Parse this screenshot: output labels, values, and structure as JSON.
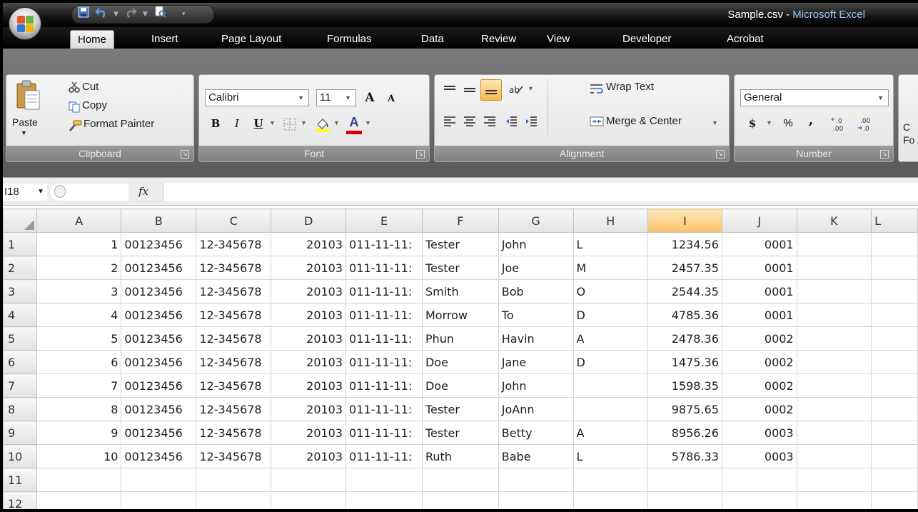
{
  "window": {
    "file_title": "Sample.csv",
    "title_sep": " - ",
    "app_title": "Microsoft Excel"
  },
  "qat": [
    "save-icon",
    "undo-icon",
    "redo-icon",
    "customize-icon"
  ],
  "tabs": [
    "Home",
    "Insert",
    "Page Layout",
    "Formulas",
    "Data",
    "Review",
    "View",
    "Developer",
    "Acrobat"
  ],
  "active_tab": "Home",
  "ribbon": {
    "clipboard": {
      "label": "Clipboard",
      "paste": "Paste",
      "cut": "Cut",
      "copy": "Copy",
      "format_painter": "Format Painter"
    },
    "font": {
      "label": "Font",
      "name": "Calibri",
      "size": "11",
      "grow": "A",
      "shrink": "A",
      "bold": "B",
      "italic": "I",
      "underline": "U",
      "font_color_glyph": "A"
    },
    "alignment": {
      "label": "Alignment",
      "wrap_text": "Wrap Text",
      "merge_center": "Merge & Center"
    },
    "number": {
      "label": "Number",
      "format": "General",
      "currency": "$",
      "percent": "%",
      "comma": ","
    },
    "cut_off": "C\nFo"
  },
  "formula_bar": {
    "cell_ref": "I18",
    "fx": "fx",
    "formula": ""
  },
  "columns": [
    "A",
    "B",
    "C",
    "D",
    "E",
    "F",
    "G",
    "H",
    "I",
    "J",
    "K",
    "L"
  ],
  "selected_column": "I",
  "rows": [
    {
      "n": "1",
      "A": "1",
      "B": "00123456",
      "C": "12-345678",
      "D": "20103",
      "E": "011-11-11:",
      "F": "Tester",
      "G": "John",
      "H": "L",
      "I": "1234.56",
      "J": "0001"
    },
    {
      "n": "2",
      "A": "2",
      "B": "00123456",
      "C": "12-345678",
      "D": "20103",
      "E": "011-11-11:",
      "F": "Tester",
      "G": "Joe",
      "H": "M",
      "I": "2457.35",
      "J": "0001"
    },
    {
      "n": "3",
      "A": "3",
      "B": "00123456",
      "C": "12-345678",
      "D": "20103",
      "E": "011-11-11:",
      "F": "Smith",
      "G": "Bob",
      "H": "O",
      "I": "2544.35",
      "J": "0001"
    },
    {
      "n": "4",
      "A": "4",
      "B": "00123456",
      "C": "12-345678",
      "D": "20103",
      "E": "011-11-11:",
      "F": "Morrow",
      "G": "To",
      "H": "D",
      "I": "4785.36",
      "J": "0001"
    },
    {
      "n": "5",
      "A": "5",
      "B": "00123456",
      "C": "12-345678",
      "D": "20103",
      "E": "011-11-11:",
      "F": "Phun",
      "G": "Havin",
      "H": "A",
      "I": "2478.36",
      "J": "0002"
    },
    {
      "n": "6",
      "A": "6",
      "B": "00123456",
      "C": "12-345678",
      "D": "20103",
      "E": "011-11-11:",
      "F": "Doe",
      "G": "Jane",
      "H": "D",
      "I": "1475.36",
      "J": "0002"
    },
    {
      "n": "7",
      "A": "7",
      "B": "00123456",
      "C": "12-345678",
      "D": "20103",
      "E": "011-11-11:",
      "F": "Doe",
      "G": "John",
      "H": "",
      "I": "1598.35",
      "J": "0002"
    },
    {
      "n": "8",
      "A": "8",
      "B": "00123456",
      "C": "12-345678",
      "D": "20103",
      "E": "011-11-11:",
      "F": "Tester",
      "G": "JoAnn",
      "H": "",
      "I": "9875.65",
      "J": "0002"
    },
    {
      "n": "9",
      "A": "9",
      "B": "00123456",
      "C": "12-345678",
      "D": "20103",
      "E": "011-11-11:",
      "F": "Tester",
      "G": "Betty",
      "H": "A",
      "I": "8956.26",
      "J": "0003"
    },
    {
      "n": "10",
      "A": "10",
      "B": "00123456",
      "C": "12-345678",
      "D": "20103",
      "E": "011-11-11:",
      "F": "Ruth",
      "G": "Babe",
      "H": "L",
      "I": "5786.33",
      "J": "0003"
    },
    {
      "n": "11",
      "A": "",
      "B": "",
      "C": "",
      "D": "",
      "E": "",
      "F": "",
      "G": "",
      "H": "",
      "I": "",
      "J": ""
    },
    {
      "n": "12",
      "A": "",
      "B": "",
      "C": "",
      "D": "",
      "E": "",
      "F": "",
      "G": "",
      "H": "",
      "I": "",
      "J": ""
    }
  ],
  "colors": {
    "selected_header": "#f8c46a",
    "font_color_bar": "#e00000",
    "highlight_bar": "#ffff00"
  }
}
